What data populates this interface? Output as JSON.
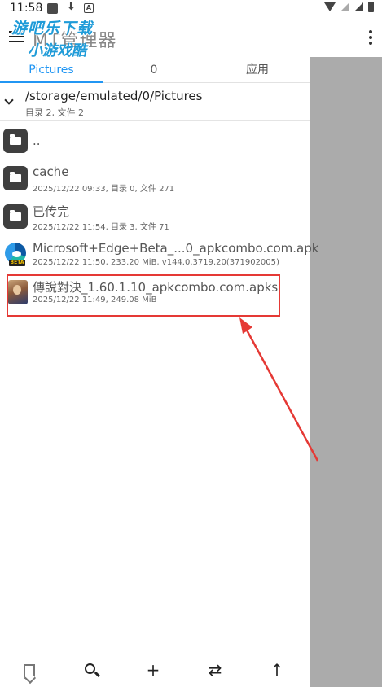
{
  "status_bar": {
    "time": "11:58",
    "download_glyph": "⬇",
    "a_badge": "A"
  },
  "app_bar": {
    "title": "MT管理器",
    "title_visible": "M",
    "watermark_line1": "游吧乐下载",
    "watermark_line2": "小游戏酷"
  },
  "tabs": [
    {
      "label": "Pictures",
      "active": true
    },
    {
      "label": "0",
      "active": false
    },
    {
      "label": "应用",
      "active": false
    }
  ],
  "path": {
    "current": "/storage/emulated/0/Pictures",
    "summary": "目录 2, 文件 2"
  },
  "files": [
    {
      "name": "..",
      "meta": "",
      "icon": "folder-icon"
    },
    {
      "name": "cache",
      "meta": "2025/12/22 09:33, 目录 0, 文件 271",
      "icon": "folder-icon"
    },
    {
      "name": "已传完",
      "meta": "2025/12/22 11:54, 目录 3, 文件 71",
      "icon": "folder-icon"
    },
    {
      "name": "Microsoft+Edge+Beta_...0_apkcombo.com.apk",
      "meta": "2025/12/22 11:50, 233.20 MiB, v144.0.3719.20(371902005)",
      "icon": "edge-beta-icon",
      "icon_tag": "BETA"
    },
    {
      "name": "傳說對決_1.60.1.10_apkcombo.com.apks",
      "meta": "2025/12/22 11:49, 249.08 MiB",
      "icon": "game-app-icon"
    }
  ],
  "bottom_bar": {
    "add_label": "+",
    "swap_label": "⇄",
    "up_label": "↑"
  },
  "colors": {
    "accent": "#2196f3",
    "highlight": "#e53935",
    "side_panel": "#ababab"
  }
}
